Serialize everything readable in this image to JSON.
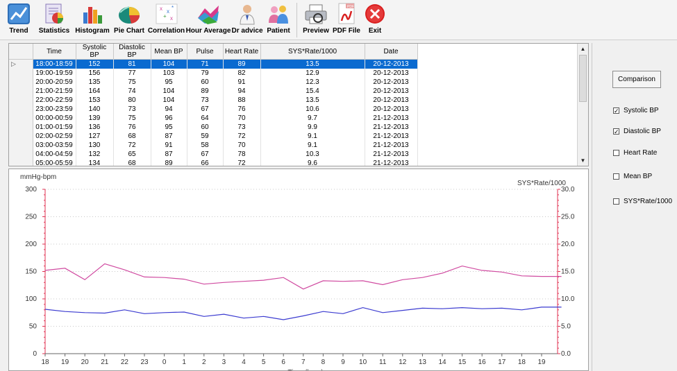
{
  "toolbar": {
    "buttons": [
      {
        "id": "trend",
        "label": "Trend",
        "icon": "trend-icon"
      },
      {
        "id": "statistics",
        "label": "Statistics",
        "icon": "statistics-icon"
      },
      {
        "id": "histogram",
        "label": "Histogram",
        "icon": "histogram-icon"
      },
      {
        "id": "pie-chart",
        "label": "Pie Chart",
        "icon": "pie-chart-icon"
      },
      {
        "id": "correlation",
        "label": "Correlation",
        "icon": "correlation-icon"
      },
      {
        "id": "hour-average",
        "label": "Hour Average",
        "icon": "hour-average-icon"
      },
      {
        "id": "dr-advice",
        "label": "Dr advice",
        "icon": "doctor-icon"
      },
      {
        "id": "patient",
        "label": "Patient",
        "icon": "patient-icon"
      },
      {
        "id": "preview",
        "label": "Preview",
        "icon": "printer-icon"
      },
      {
        "id": "pdf-file",
        "label": "PDF File",
        "icon": "pdf-icon"
      },
      {
        "id": "exit",
        "label": "Exit",
        "icon": "exit-icon"
      }
    ]
  },
  "table": {
    "selected_marker": "▷",
    "columns": [
      "Time",
      "Systolic BP",
      "Diastolic BP",
      "Mean BP",
      "Pulse",
      "Heart Rate",
      "SYS*Rate/1000",
      "Date"
    ],
    "rows": [
      [
        "18:00-18:59",
        "152",
        "81",
        "104",
        "71",
        "89",
        "13.5",
        "20-12-2013"
      ],
      [
        "19:00-19:59",
        "156",
        "77",
        "103",
        "79",
        "82",
        "12.9",
        "20-12-2013"
      ],
      [
        "20:00-20:59",
        "135",
        "75",
        "95",
        "60",
        "91",
        "12.3",
        "20-12-2013"
      ],
      [
        "21:00-21:59",
        "164",
        "74",
        "104",
        "89",
        "94",
        "15.4",
        "20-12-2013"
      ],
      [
        "22:00-22:59",
        "153",
        "80",
        "104",
        "73",
        "88",
        "13.5",
        "20-12-2013"
      ],
      [
        "23:00-23:59",
        "140",
        "73",
        "94",
        "67",
        "76",
        "10.6",
        "20-12-2013"
      ],
      [
        "00:00-00:59",
        "139",
        "75",
        "96",
        "64",
        "70",
        "9.7",
        "21-12-2013"
      ],
      [
        "01:00-01:59",
        "136",
        "76",
        "95",
        "60",
        "73",
        "9.9",
        "21-12-2013"
      ],
      [
        "02:00-02:59",
        "127",
        "68",
        "87",
        "59",
        "72",
        "9.1",
        "21-12-2013"
      ],
      [
        "03:00-03:59",
        "130",
        "72",
        "91",
        "58",
        "70",
        "9.1",
        "21-12-2013"
      ],
      [
        "04:00-04:59",
        "132",
        "65",
        "87",
        "67",
        "78",
        "10.3",
        "21-12-2013"
      ],
      [
        "05:00-05:59",
        "134",
        "68",
        "89",
        "66",
        "72",
        "9.6",
        "21-12-2013"
      ]
    ],
    "selected_row": 0
  },
  "right_panel": {
    "compare_label": "Comparison",
    "checkboxes": [
      {
        "label": "Systolic BP",
        "checked": true
      },
      {
        "label": "Diastolic BP",
        "checked": true
      },
      {
        "label": "Heart Rate",
        "checked": false
      },
      {
        "label": "Mean BP",
        "checked": false
      },
      {
        "label": "SYS*Rate/1000",
        "checked": false
      }
    ]
  },
  "colors": {
    "selection": "#0a6ad0",
    "systolic": "#d04aa0",
    "diastolic": "#3a3ad0",
    "axis": "#e03050",
    "exit": "#d92020"
  },
  "chart_data": {
    "type": "line",
    "ylabel": "mmHg-bpm",
    "y2label": "SYS*Rate/1000",
    "xlabel": "Time  (hour)",
    "ylim": [
      0,
      300
    ],
    "y2lim": [
      0,
      30
    ],
    "yticks": [
      "0",
      "50",
      "100",
      "150",
      "200",
      "250",
      "300"
    ],
    "y2ticks": [
      "0.0",
      "5.0",
      "10.0",
      "15.0",
      "20.0",
      "25.0",
      "30.0"
    ],
    "categories": [
      "18",
      "19",
      "20",
      "21",
      "22",
      "23",
      "0",
      "1",
      "2",
      "3",
      "4",
      "5",
      "6",
      "7",
      "8",
      "9",
      "10",
      "11",
      "12",
      "13",
      "14",
      "15",
      "16",
      "17",
      "18",
      "19"
    ],
    "grid": true,
    "series": [
      {
        "name": "Systolic BP",
        "color": "#d04aa0",
        "values": [
          152,
          156,
          135,
          164,
          153,
          140,
          139,
          136,
          127,
          130,
          132,
          134,
          139,
          118,
          133,
          132,
          133,
          126,
          135,
          139,
          147,
          160,
          152,
          149,
          142,
          141,
          141
        ]
      },
      {
        "name": "Diastolic BP",
        "color": "#3a3ad0",
        "values": [
          81,
          77,
          75,
          74,
          80,
          73,
          75,
          76,
          68,
          72,
          65,
          68,
          62,
          69,
          77,
          73,
          84,
          75,
          79,
          83,
          82,
          84,
          82,
          83,
          80,
          85,
          85
        ]
      }
    ]
  }
}
